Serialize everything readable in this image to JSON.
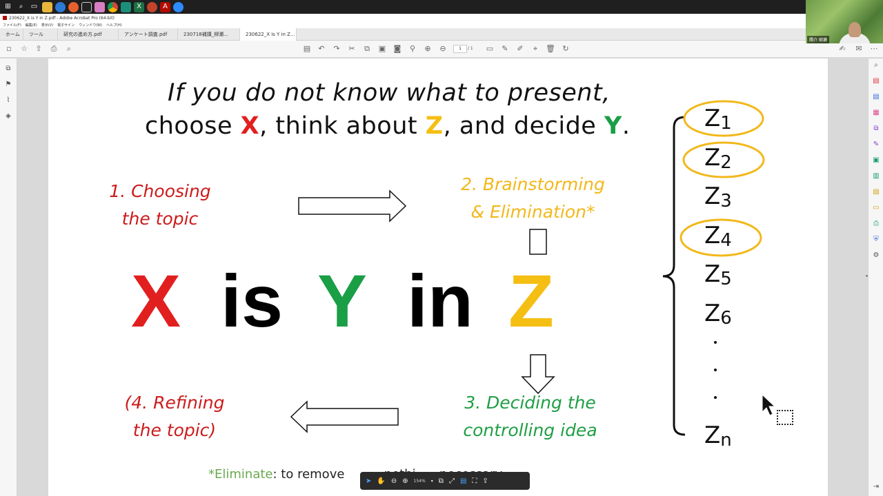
{
  "taskbar": {
    "icons": [
      "windows-icon",
      "search-icon",
      "task-view-icon",
      "explorer-icon",
      "edge-icon",
      "firefox-icon",
      "inkscape-icon",
      "app-icon",
      "chrome-icon",
      "excel-icon",
      "powerpoint-icon",
      "acrobat-icon",
      "zoom-icon"
    ]
  },
  "window": {
    "title": "230622_X is Y in Z.pdf - Adobe Acrobat Pro (64-bit)",
    "menu": [
      "ファイル(F)",
      "編集(E)",
      "表示(V)",
      "電子サイン",
      "ウィンドウ(W)",
      "ヘルプ(H)"
    ]
  },
  "tabs": [
    {
      "label": "ホーム"
    },
    {
      "label": "ツール"
    },
    {
      "label": "研究の進め方.pdf"
    },
    {
      "label": "アンケート調査.pdf"
    },
    {
      "label": "230718補講_柳瀬..."
    },
    {
      "label": "230622_X is Y in Z..."
    }
  ],
  "toolbar": {
    "page_current": "1",
    "page_total": "/ 1"
  },
  "slide": {
    "title_line1": "If you do not know what to present,",
    "title_line2_a": "choose ",
    "title_line2_x": "X",
    "title_line2_b": ", think about ",
    "title_line2_z": "Z",
    "title_line2_c": ", and decide ",
    "title_line2_y": "Y",
    "title_line2_d": ".",
    "step1_line1": "1. Choosing",
    "step1_line2": "the topic",
    "step2_line1": "2. Brainstorming",
    "step2_line2": "& Elimination*",
    "step3_line1": "3. Deciding the",
    "step3_line2": "controlling idea",
    "step4_line1": "(4. Refining",
    "step4_line2": "the topic)",
    "big_x": "X",
    "big_is": "is",
    "big_y": "Y",
    "big_in": "in",
    "big_z": "Z",
    "z_items": [
      {
        "base": "Z",
        "sub": "1",
        "circled": true
      },
      {
        "base": "Z",
        "sub": "2",
        "circled": true
      },
      {
        "base": "Z",
        "sub": "3",
        "circled": false
      },
      {
        "base": "Z",
        "sub": "4",
        "circled": true
      },
      {
        "base": "Z",
        "sub": "5",
        "circled": false
      },
      {
        "base": "Z",
        "sub": "6",
        "circled": false
      },
      {
        "base": "Z",
        "sub": "n",
        "circled": false
      }
    ],
    "footnote_star": "*Eliminate",
    "footnote_rest": ": to remove          nethi      necessary"
  },
  "floatbar": {
    "zoom": "154%"
  },
  "webcam": {
    "name": "隅介 柳瀬"
  },
  "colors": {
    "red": "#e21f1f",
    "green": "#1a9e46",
    "yellow": "#f5be12",
    "step_red": "#cc1b1b",
    "step_yellow": "#f2b81a",
    "step_green": "#1f9e45",
    "circle": "#f2b81a"
  }
}
